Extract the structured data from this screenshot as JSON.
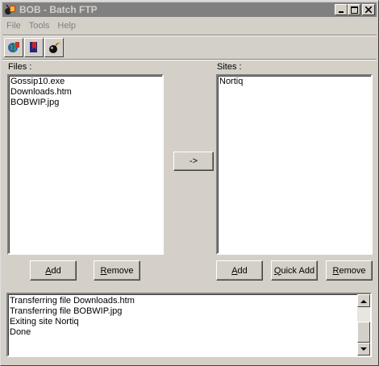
{
  "window": {
    "title": "BOB - Batch FTP",
    "controls": {
      "minimize": "_",
      "maximize": "□",
      "close": "✕"
    }
  },
  "menu": {
    "items": [
      "File",
      "Tools",
      "Help"
    ]
  },
  "toolbar": {
    "icons": [
      "globe-icon",
      "bookmark-icon",
      "bomb-icon"
    ]
  },
  "files": {
    "label": "Files :",
    "items": [
      "Gossip10.exe",
      "Downloads.htm",
      "BOBWIP.jpg"
    ],
    "add_accel": "A",
    "add_rest": "dd",
    "remove_accel": "R",
    "remove_rest": "emove"
  },
  "transfer": {
    "label": "->"
  },
  "sites": {
    "label": "Sites :",
    "items": [
      "Nortiq"
    ],
    "add_accel": "A",
    "add_rest": "dd",
    "quick_add_accel": "Q",
    "quick_add_rest": "uick Add",
    "remove_accel": "R",
    "remove_rest": "emove"
  },
  "log": {
    "lines": [
      "Transferring file Downloads.htm",
      "Transferring file BOBWIP.jpg",
      "Exiting site Nortiq",
      "Done"
    ]
  }
}
